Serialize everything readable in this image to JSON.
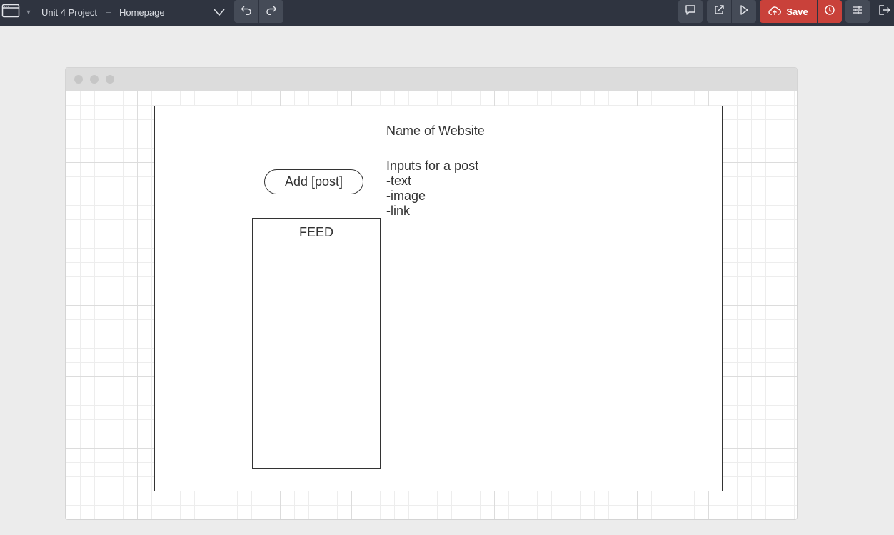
{
  "toolbar": {
    "project_title": "Unit 4 Project",
    "separator": "–",
    "page_name": "Homepage",
    "save_label": "Save",
    "icons": {
      "app": "browser-window-icon",
      "app_caret": "caret-down-icon",
      "page_menu": "chevron-down-icon",
      "undo": "undo-icon",
      "redo": "redo-icon",
      "comment": "comment-icon",
      "share": "external-link-icon",
      "preview": "play-icon",
      "save": "cloud-upload-icon",
      "history": "clock-icon",
      "settings": "sliders-icon",
      "exit": "exit-icon"
    },
    "colors": {
      "bar": "#2f3440",
      "button": "#454b57",
      "save": "#c9413a"
    }
  },
  "wireframe": {
    "site_name": "Name of Website",
    "add_post_button": "Add [post]",
    "feed_label": "FEED",
    "inputs_heading": "Inputs for a post",
    "inputs_items": [
      "-text",
      "-image",
      "-link"
    ]
  }
}
